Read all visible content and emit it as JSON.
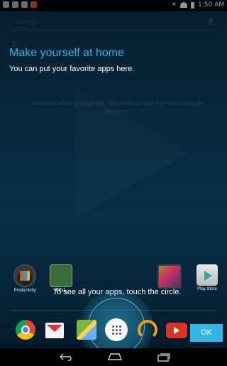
{
  "status_bar": {
    "time": "1:50 AM"
  },
  "search": {
    "label": "Google"
  },
  "cling": {
    "title": "Make yourself at home",
    "body": "You can put your favorite apps here.",
    "auth_message": "Authentication is required. You need to sign into your Google Account.",
    "hint": "To see all your apps, touch the circle.",
    "ok_label": "OK"
  },
  "workspace_icons": [
    {
      "label": "Productivity",
      "icon": "productivity-folder-icon"
    },
    {
      "label": "DELL",
      "icon": "dell-icon"
    },
    {
      "label": "",
      "icon": "photos-icon"
    },
    {
      "label": "Play Store",
      "icon": "play-store-icon"
    }
  ],
  "hotseat": [
    "chrome-icon",
    "gmail-icon",
    "maps-icon",
    "all-apps-icon",
    "play-music-icon",
    "youtube-icon"
  ],
  "colors": {
    "accent": "#33b5e5",
    "background": "#0b3b57"
  }
}
